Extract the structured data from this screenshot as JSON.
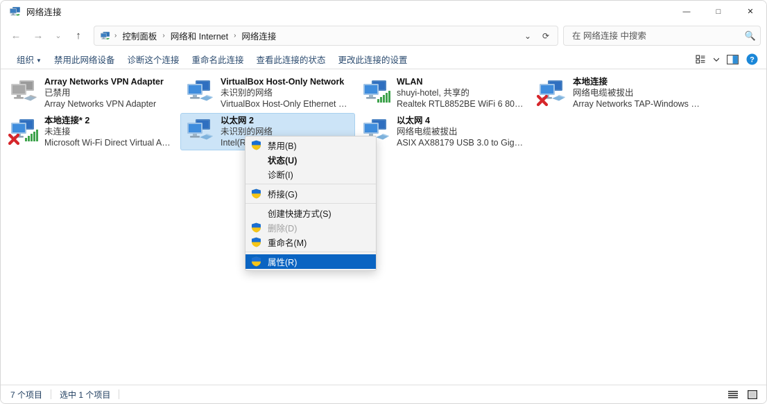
{
  "window": {
    "title": "网络连接",
    "icon": "network-connections-icon",
    "controls": {
      "minimize": "—",
      "maximize": "□",
      "close": "✕"
    }
  },
  "nav": {
    "back": "←",
    "forward": "→",
    "recent": "⌄",
    "up": "↑",
    "dropdown": "⌄",
    "refresh": "⟳"
  },
  "breadcrumb": {
    "icon": "network-connections-icon",
    "separator": "›",
    "items": [
      "控制面板",
      "网络和 Internet",
      "网络连接"
    ]
  },
  "search": {
    "placeholder": "在 网络连接 中搜索",
    "value": "",
    "icon": "search-icon"
  },
  "commandbar": {
    "items": [
      {
        "label": "组织",
        "has_caret": true
      },
      {
        "label": "禁用此网络设备",
        "has_caret": false
      },
      {
        "label": "诊断这个连接",
        "has_caret": false
      },
      {
        "label": "重命名此连接",
        "has_caret": false
      },
      {
        "label": "查看此连接的状态",
        "has_caret": false
      },
      {
        "label": "更改此连接的设置",
        "has_caret": false
      }
    ],
    "right_icons": [
      "view-options-icon",
      "view-options-caret",
      "preview-pane-icon",
      "help-icon"
    ]
  },
  "connections": [
    {
      "name": "Array Networks VPN Adapter",
      "status": "已禁用",
      "device": "Array Networks VPN Adapter",
      "icon": "network-adapter-disabled-icon",
      "icon_style": "gray",
      "overlay": "none",
      "selected": false
    },
    {
      "name": "VirtualBox Host-Only Network",
      "status": "未识别的网络",
      "device": "VirtualBox Host-Only Ethernet …",
      "icon": "network-adapter-icon",
      "icon_style": "blue",
      "overlay": "none",
      "selected": false
    },
    {
      "name": "WLAN",
      "status": "shuyi-hotel, 共享的",
      "device": "Realtek RTL8852BE WiFi 6 802....",
      "icon": "wireless-adapter-icon",
      "icon_style": "blue",
      "overlay": "wifi-bars",
      "selected": false
    },
    {
      "name": "本地连接",
      "status": "网络电缆被拔出",
      "device": "Array Networks TAP-Windows …",
      "icon": "network-adapter-icon",
      "icon_style": "blue",
      "overlay": "red-x",
      "selected": false
    },
    {
      "name": "本地连接* 2",
      "status": "未连接",
      "device": "Microsoft Wi-Fi Direct Virtual A…",
      "icon": "wireless-adapter-icon",
      "icon_style": "blue",
      "overlay": "red-x-wifi",
      "selected": false
    },
    {
      "name": "以太网 2",
      "status": "未识别的网络",
      "device": "Intel(R…",
      "icon": "network-adapter-icon",
      "icon_style": "blue",
      "overlay": "none",
      "selected": true
    },
    {
      "name": "以太网 4",
      "status": "网络电缆被拔出",
      "device": "ASIX AX88179 USB 3.0 to Giga…",
      "icon": "network-adapter-icon",
      "icon_style": "blue",
      "overlay": "none",
      "selected": false
    }
  ],
  "context_menu": {
    "items": [
      {
        "label": "禁用(B)",
        "shield": true,
        "bold": false,
        "disabled": false,
        "highlight": false
      },
      {
        "label": "状态(U)",
        "shield": false,
        "bold": true,
        "disabled": false,
        "highlight": false
      },
      {
        "label": "诊断(I)",
        "shield": false,
        "bold": false,
        "disabled": false,
        "highlight": false
      },
      {
        "separator": true
      },
      {
        "label": "桥接(G)",
        "shield": true,
        "bold": false,
        "disabled": false,
        "highlight": false
      },
      {
        "separator": true
      },
      {
        "label": "创建快捷方式(S)",
        "shield": false,
        "bold": false,
        "disabled": false,
        "highlight": false
      },
      {
        "label": "删除(D)",
        "shield": true,
        "bold": false,
        "disabled": true,
        "highlight": false
      },
      {
        "label": "重命名(M)",
        "shield": true,
        "bold": false,
        "disabled": false,
        "highlight": false
      },
      {
        "separator": true
      },
      {
        "label": "属性(R)",
        "shield": true,
        "bold": false,
        "disabled": false,
        "highlight": true
      }
    ]
  },
  "statusbar": {
    "item_count": "7 个项目",
    "selection": "选中 1 个项目",
    "views": [
      "details-view-icon",
      "tiles-view-icon"
    ]
  },
  "colors": {
    "accent": "#0a64c2",
    "selection_bg": "#cce4f7",
    "command_text": "#2b4b6f",
    "shield_blue": "#1a6fd4",
    "shield_yellow": "#f5c518",
    "red_x": "#d6262b"
  }
}
